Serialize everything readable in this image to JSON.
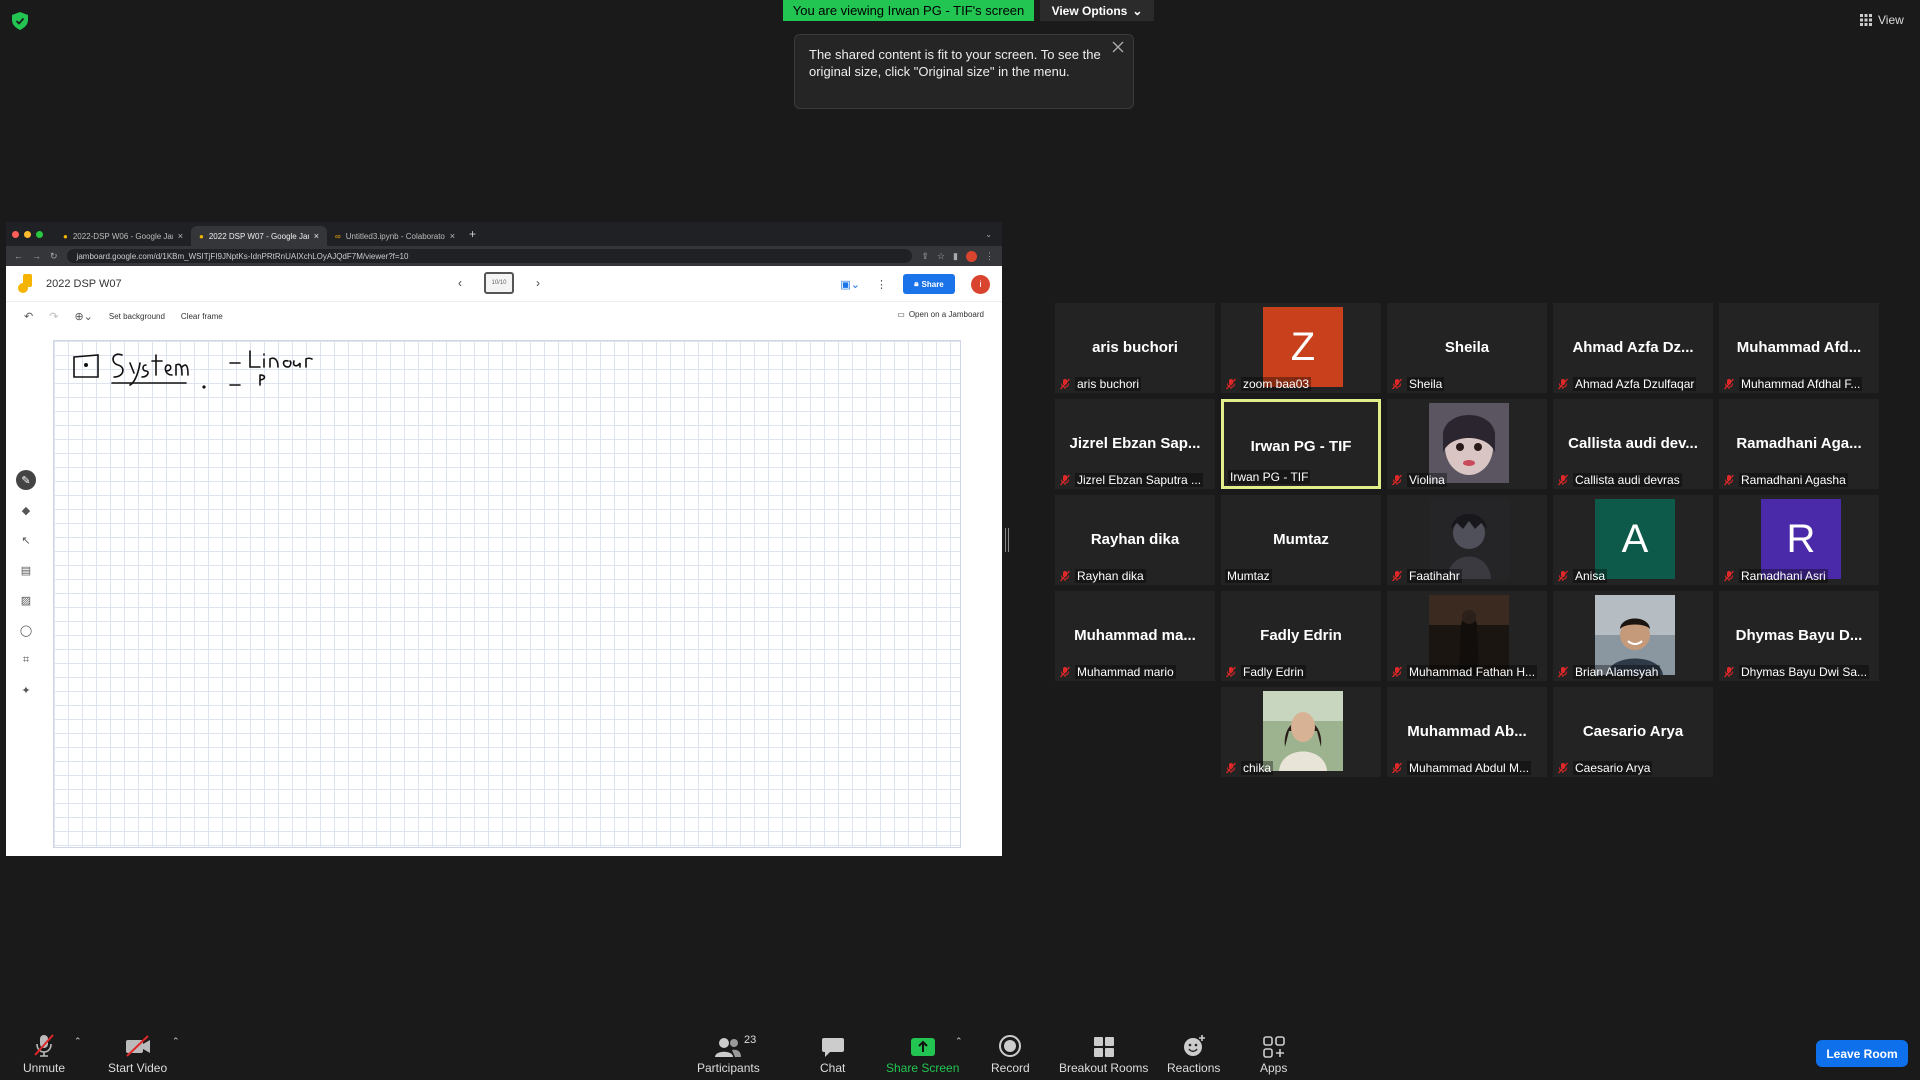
{
  "window": {
    "viewing_banner": "You are viewing Irwan PG - TIF's screen",
    "view_options_label": "View Options",
    "tooltip_text": "The shared content is fit to your screen. To see the original size, click \"Original size\" in the menu.",
    "view_label": "View"
  },
  "browser": {
    "tabs": [
      {
        "label": "2022-DSP W06 - Google Jam"
      },
      {
        "label": "2022 DSP W07 - Google Jam"
      },
      {
        "label": "Untitled3.ipynb - Colaboratory"
      }
    ],
    "new_tab": "+",
    "url": "jamboard.google.com/d/1KBm_WSITjFI9JNptKs-IdnPRtRnUAIXchLOyAJQdF7M/viewer?f=10"
  },
  "jamboard": {
    "title": "2022 DSP W07",
    "frame_thumb_text": "10/10",
    "share_label": "Share",
    "user_initial": "i",
    "set_background": "Set background",
    "clear_frame": "Clear frame",
    "open_on_jamboard": "Open on a Jamboard"
  },
  "gallery": {
    "tiles": [
      {
        "big": "aris buchori",
        "label": "aris buchori",
        "muted": true
      },
      {
        "avatar_letter": "Z",
        "avatar_color": "#c8401c",
        "label": "zoom baa03",
        "muted": true
      },
      {
        "big": "Sheila",
        "label": "Sheila",
        "muted": true
      },
      {
        "big": "Ahmad Azfa Dz...",
        "label": "Ahmad Azfa Dzulfaqar",
        "muted": true
      },
      {
        "big": "Muhammad Afd...",
        "label": "Muhammad Afdhal F...",
        "muted": true
      },
      {
        "big": "Jizrel Ebzan Sap...",
        "label": "Jizrel Ebzan Saputra ...",
        "muted": true
      },
      {
        "big": "Irwan PG - TIF",
        "label": "Irwan PG - TIF",
        "muted": false,
        "speaking": true
      },
      {
        "photo": "anime-portrait",
        "label": "Violina",
        "muted": true
      },
      {
        "big": "Callista audi dev...",
        "label": "Callista audi devras",
        "muted": true
      },
      {
        "big": "Ramadhani Aga...",
        "label": "Ramadhani Agasha",
        "muted": true
      },
      {
        "big": "Rayhan dika",
        "label": "Rayhan dika",
        "muted": true
      },
      {
        "big": "Mumtaz",
        "label": "Mumtaz",
        "muted": false
      },
      {
        "photo": "anime-dark",
        "label": "Faatihahr",
        "muted": true
      },
      {
        "avatar_letter": "A",
        "avatar_color": "#0d5a4a",
        "label": "Anisa",
        "muted": true
      },
      {
        "avatar_letter": "R",
        "avatar_color": "#4a2aa8",
        "label": "Ramadhani Asri",
        "muted": true
      },
      {
        "big": "Muhammad ma...",
        "label": "Muhammad mario",
        "muted": true
      },
      {
        "big": "Fadly Edrin",
        "label": "Fadly Edrin",
        "muted": true
      },
      {
        "photo": "dark-outdoor",
        "label": "Muhammad Fathan H...",
        "muted": true
      },
      {
        "photo": "person-smiling",
        "label": "Brian Alamsyah",
        "muted": true
      },
      {
        "big": "Dhymas Bayu D...",
        "label": "Dhymas Bayu Dwi Sa...",
        "muted": true
      },
      {
        "photo": "woman-portrait",
        "label": "chika",
        "muted": true
      },
      {
        "big": "Muhammad Ab...",
        "label": "Muhammad Abdul M...",
        "muted": true
      },
      {
        "big": "Caesario Arya",
        "label": "Caesario Arya",
        "muted": true
      }
    ]
  },
  "toolbar": {
    "unmute": "Unmute",
    "start_video": "Start Video",
    "participants": "Participants",
    "participant_count": "23",
    "chat": "Chat",
    "share_screen": "Share Screen",
    "record": "Record",
    "breakout_rooms": "Breakout Rooms",
    "reactions": "Reactions",
    "apps": "Apps",
    "leave_room": "Leave Room"
  },
  "colors": {
    "banner_green": "#23c552",
    "leave_blue": "#0e71eb",
    "speaking_border": "#e2ee8a",
    "muted_red": "#e02828"
  }
}
